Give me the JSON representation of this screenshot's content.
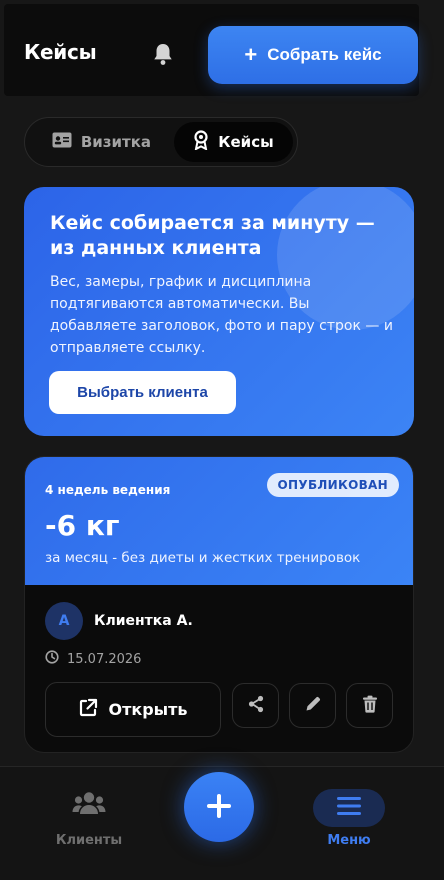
{
  "header": {
    "title": "Кейсы",
    "build_button_label": "Собрать кейс"
  },
  "segment": {
    "items": [
      {
        "label": "Визитка",
        "icon": "id-card-icon",
        "active": false
      },
      {
        "label": "Кейсы",
        "icon": "award-icon",
        "active": true
      }
    ]
  },
  "hero": {
    "title": "Кейс собирается за минуту — из данных клиента",
    "text": "Вес, замеры, график и дисциплина подтягиваются автоматически. Вы добавляете заголовок, фото и пару строк — и отправляете ссылку.",
    "button_label": "Выбрать клиента"
  },
  "case_card": {
    "duration": "4 недель ведения",
    "badge": "ОПУБЛИКОВАН",
    "result": "-6 кг",
    "subtitle": "за месяц - без диеты и жестких тренировок",
    "avatar_letter": "А",
    "client_name": "Клиентка А.",
    "date": "15.07.2026",
    "open_label": "Открыть",
    "actions": [
      "share-icon",
      "pencil-icon",
      "trash-icon"
    ]
  },
  "bottom_nav": {
    "clients_label": "Клиенты",
    "menu_label": "Меню"
  },
  "colors": {
    "accent": "#2f6fe8",
    "background": "#171717",
    "card": "#0b0b0b"
  }
}
